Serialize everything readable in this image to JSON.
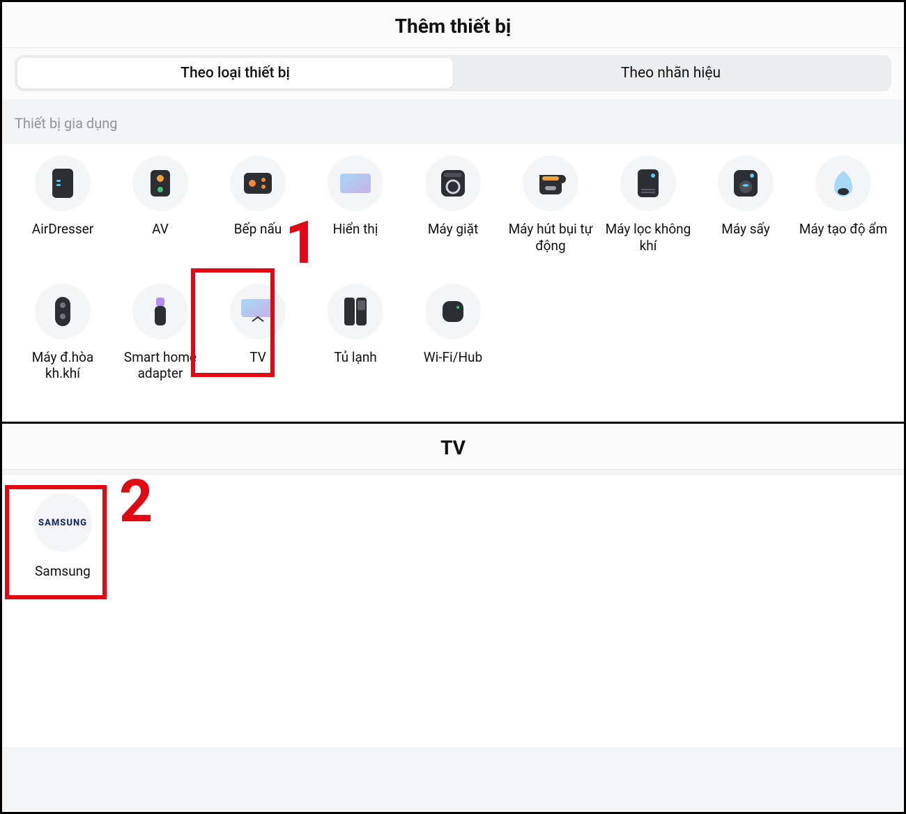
{
  "top": {
    "title": "Thêm thiết bị",
    "tabs": {
      "by_type": "Theo loại thiết bị",
      "by_brand": "Theo nhãn hiệu"
    },
    "section_label": "Thiết bị gia dụng",
    "devices": [
      {
        "key": "airdresser",
        "label": "AirDresser"
      },
      {
        "key": "av",
        "label": "AV"
      },
      {
        "key": "stove",
        "label": "Bếp nấu"
      },
      {
        "key": "display",
        "label": "Hiển thị"
      },
      {
        "key": "washer",
        "label": "Máy giặt"
      },
      {
        "key": "robot_vacuum",
        "label": "Máy hút bụi tự động"
      },
      {
        "key": "air_purifier",
        "label": "Máy lọc không khí"
      },
      {
        "key": "dryer",
        "label": "Máy sấy"
      },
      {
        "key": "humidifier",
        "label": "Máy tạo độ ẩm"
      },
      {
        "key": "ac",
        "label": "Máy đ.hòa kh.khí"
      },
      {
        "key": "smarthome_adapter",
        "label": "Smart home adapter"
      },
      {
        "key": "tv",
        "label": "TV"
      },
      {
        "key": "fridge",
        "label": "Tủ lạnh"
      },
      {
        "key": "wifi_hub",
        "label": "Wi-Fi/Hub"
      }
    ],
    "step_number": "1"
  },
  "bottom": {
    "title": "TV",
    "brand": {
      "logo_text": "SAMSUNG",
      "label": "Samsung"
    },
    "step_number": "2"
  }
}
